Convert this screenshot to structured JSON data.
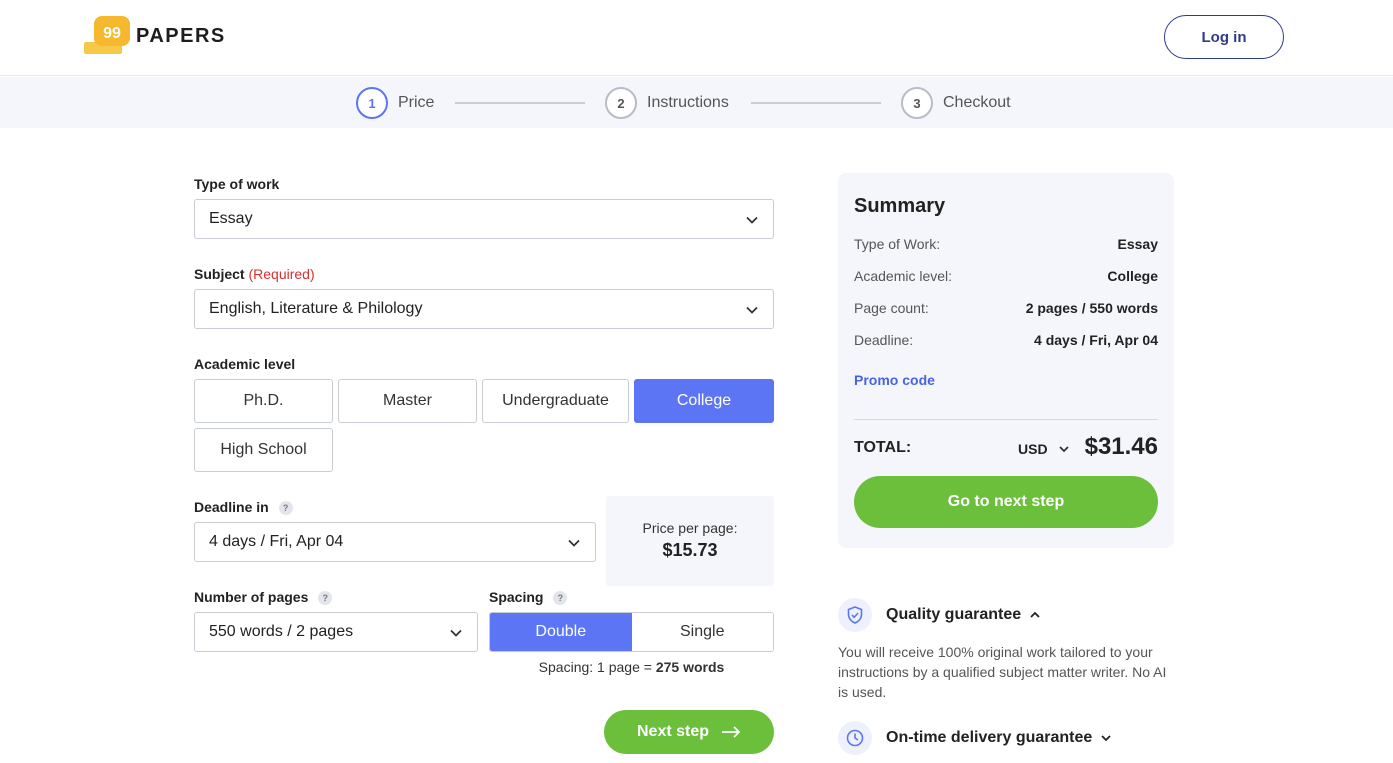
{
  "header": {
    "logo_text": "PAPERS",
    "logo_mark_text": "99",
    "login_label": "Log in"
  },
  "steps": [
    {
      "number": "1",
      "label": "Price",
      "active": true
    },
    {
      "number": "2",
      "label": "Instructions",
      "active": false
    },
    {
      "number": "3",
      "label": "Checkout",
      "active": false
    }
  ],
  "form": {
    "type_of_work": {
      "label": "Type of work",
      "value": "Essay"
    },
    "subject": {
      "label": "Subject",
      "required_label": "(Required)",
      "value": "English, Literature & Philology"
    },
    "academic_level": {
      "label": "Academic level",
      "options": [
        "Ph.D.",
        "Master",
        "Undergraduate",
        "College",
        "High School"
      ],
      "selected": "College"
    },
    "deadline": {
      "label": "Deadline in",
      "help": "?",
      "value": "4 days / Fri, Apr 04"
    },
    "price_per_page": {
      "label": "Price per page:",
      "value": "$15.73"
    },
    "pages": {
      "label": "Number of pages",
      "help": "?",
      "value": "550 words / 2 pages"
    },
    "spacing": {
      "label": "Spacing",
      "help": "?",
      "options": [
        "Double",
        "Single"
      ],
      "selected": "Double",
      "note_prefix": "Spacing: 1 page =",
      "note_value": "275 words"
    },
    "next_label": "Next step"
  },
  "summary": {
    "title": "Summary",
    "rows": [
      {
        "key": "Type of Work:",
        "value": "Essay"
      },
      {
        "key": "Academic level:",
        "value": "College"
      },
      {
        "key": "Page count:",
        "value": "2 pages / 550 words"
      },
      {
        "key": "Deadline:",
        "value": "4 days / Fri, Apr 04"
      }
    ],
    "promo_label": "Promo code",
    "total_label": "TOTAL:",
    "currency": "USD",
    "total_value": "$31.46",
    "go_label": "Go to next step"
  },
  "guarantees": {
    "quality": {
      "title": "Quality guarantee",
      "text": "You will receive 100% original work tailored to your instructions by a qualified subject matter writer. No AI is used."
    },
    "delivery": {
      "title": "On-time delivery guarantee"
    }
  },
  "colors": {
    "accent": "#5b75f5",
    "cta": "#6bbf3b",
    "brand_yellow": "#f5b82e",
    "nav_blue": "#2f3a8f"
  }
}
